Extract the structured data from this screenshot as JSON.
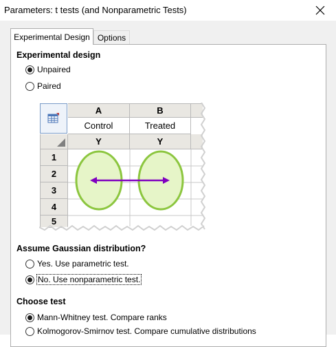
{
  "window": {
    "title": "Parameters: t tests (and Nonparametric Tests)"
  },
  "tabs": [
    {
      "label": "Experimental Design",
      "active": true
    },
    {
      "label": "Options",
      "active": false
    }
  ],
  "experimental_design": {
    "heading": "Experimental design",
    "options": [
      {
        "label": "Unpaired",
        "selected": true
      },
      {
        "label": "Paired",
        "selected": false
      }
    ]
  },
  "sheet": {
    "columns": [
      {
        "letter": "A",
        "name": "Control",
        "sub": "Y"
      },
      {
        "letter": "B",
        "name": "Treated",
        "sub": "Y"
      }
    ],
    "rows": [
      "1",
      "2",
      "3",
      "4",
      "5"
    ],
    "icon": "table-icon"
  },
  "gaussian": {
    "heading": "Assume Gaussian distribution?",
    "options": [
      {
        "label": "Yes. Use parametric test.",
        "selected": false
      },
      {
        "label": "No. Use nonparametric test.",
        "selected": true
      }
    ]
  },
  "choose_test": {
    "heading": "Choose test",
    "options": [
      {
        "label": "Mann-Whitney test. Compare ranks",
        "selected": true
      },
      {
        "label": "Kolmogorov-Smirnov test. Compare cumulative distributions",
        "selected": false
      }
    ]
  },
  "colors": {
    "ellipse_fill": "#e6f5c8",
    "ellipse_stroke": "#8cc63f",
    "arrow": "#8000c0"
  }
}
